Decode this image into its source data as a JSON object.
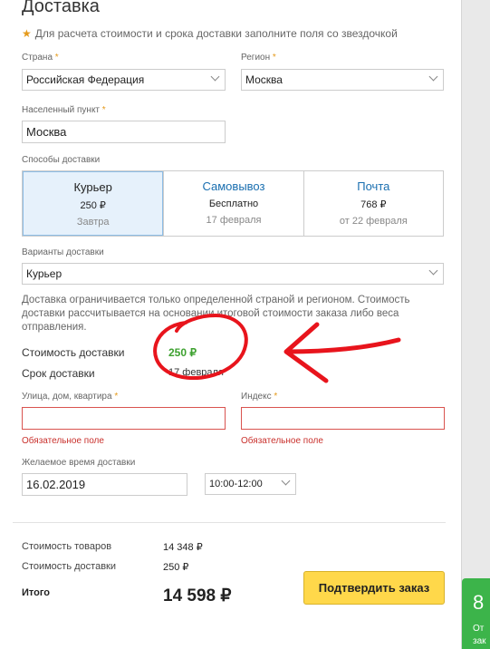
{
  "title": "Доставка",
  "hint": "Для расчета стоимости и срока доставки заполните поля со звездочкой",
  "country": {
    "label": "Страна",
    "value": "Российская Федерация"
  },
  "region": {
    "label": "Регион",
    "value": "Москва"
  },
  "city": {
    "label": "Населенный пункт",
    "value": "Москва"
  },
  "methods_label": "Способы доставки",
  "methods": [
    {
      "name": "Курьер",
      "price": "250 ₽",
      "date": "Завтра"
    },
    {
      "name": "Самовывоз",
      "price": "Бесплатно",
      "date": "17 февраля"
    },
    {
      "name": "Почта",
      "price": "768 ₽",
      "date": "от 22 февраля"
    }
  ],
  "variant": {
    "label": "Варианты доставки",
    "value": "Курьер"
  },
  "note": "Доставка ограничивается только определенной страной и регионом. Стоимость доставки рассчитывается на основании итоговой стоимости заказа либо веса отправления.",
  "delivery_cost": {
    "label": "Стоимость доставки",
    "value": "250 ₽"
  },
  "delivery_time": {
    "label": "Срок доставки",
    "value": "17 февраля"
  },
  "street": {
    "label": "Улица, дом, квартира",
    "error": "Обязательное поле"
  },
  "zip": {
    "label": "Индекс",
    "error": "Обязательное поле"
  },
  "desired_time": {
    "label": "Желаемое время доставки",
    "date": "16.02.2019",
    "slot": "10:00-12:00"
  },
  "summary": {
    "goods_label": "Стоимость товаров",
    "goods_value": "14 348 ₽",
    "delivery_label": "Стоимость доставки",
    "delivery_value": "250 ₽",
    "total_label": "Итого",
    "total_value": "14 598 ₽"
  },
  "confirm_label": "Подтвердить заказ",
  "side_widget": {
    "big": "8",
    "line1": "От",
    "line2": "зак"
  },
  "colors": {
    "accent_yellow": "#ffd84a",
    "link_blue": "#1a6fb0",
    "error_red": "#d9534f",
    "price_green": "#3da12f",
    "annotation_red": "#e8141c"
  }
}
